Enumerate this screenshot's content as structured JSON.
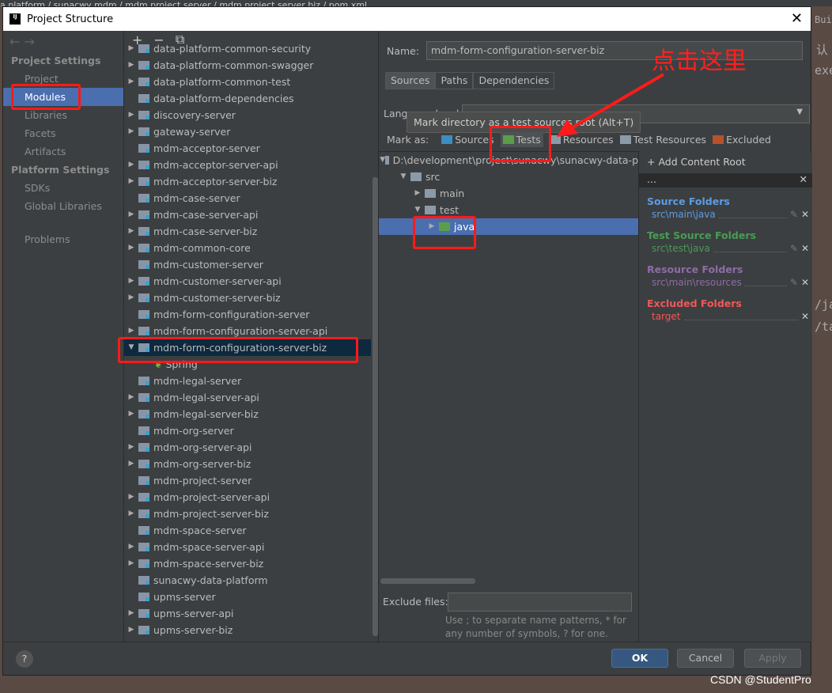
{
  "background": {
    "breadcrumb": "a platform / sunacwy mdm / mdm project server / mdm project server biz / pom.xml",
    "side_text": [
      "Buil",
      "认",
      "exe",
      "/ja",
      "/ta"
    ],
    "watermark": "CSDN @StudentPro"
  },
  "dialog": {
    "title": "Project Structure",
    "close": "✕"
  },
  "left": {
    "project_settings": "Project Settings",
    "items1": [
      "Project",
      "Modules",
      "Libraries",
      "Facets",
      "Artifacts"
    ],
    "platform_settings": "Platform Settings",
    "items2": [
      "SDKs",
      "Global Libraries"
    ],
    "problems": "Problems",
    "selected": "Modules"
  },
  "modules_toolbar": {
    "add": "+",
    "remove": "−",
    "copy": "⧉"
  },
  "modules": [
    {
      "name": "data-platform-common-security",
      "arrow": "right"
    },
    {
      "name": "data-platform-common-swagger",
      "arrow": "right"
    },
    {
      "name": "data-platform-common-test",
      "arrow": "right"
    },
    {
      "name": "data-platform-dependencies",
      "arrow": ""
    },
    {
      "name": "discovery-server",
      "arrow": "right"
    },
    {
      "name": "gateway-server",
      "arrow": "right"
    },
    {
      "name": "mdm-acceptor-server",
      "arrow": ""
    },
    {
      "name": "mdm-acceptor-server-api",
      "arrow": "right"
    },
    {
      "name": "mdm-acceptor-server-biz",
      "arrow": "right"
    },
    {
      "name": "mdm-case-server",
      "arrow": ""
    },
    {
      "name": "mdm-case-server-api",
      "arrow": "right"
    },
    {
      "name": "mdm-case-server-biz",
      "arrow": "right"
    },
    {
      "name": "mdm-common-core",
      "arrow": "right"
    },
    {
      "name": "mdm-customer-server",
      "arrow": ""
    },
    {
      "name": "mdm-customer-server-api",
      "arrow": "right"
    },
    {
      "name": "mdm-customer-server-biz",
      "arrow": "right"
    },
    {
      "name": "mdm-form-configuration-server",
      "arrow": ""
    },
    {
      "name": "mdm-form-configuration-server-api",
      "arrow": "right"
    },
    {
      "name": "mdm-form-configuration-server-biz",
      "arrow": "down",
      "selected": true
    },
    {
      "name": "Spring",
      "arrow": "",
      "child": true
    },
    {
      "name": "mdm-legal-server",
      "arrow": ""
    },
    {
      "name": "mdm-legal-server-api",
      "arrow": "right"
    },
    {
      "name": "mdm-legal-server-biz",
      "arrow": "right"
    },
    {
      "name": "mdm-org-server",
      "arrow": ""
    },
    {
      "name": "mdm-org-server-api",
      "arrow": "right"
    },
    {
      "name": "mdm-org-server-biz",
      "arrow": "right"
    },
    {
      "name": "mdm-project-server",
      "arrow": ""
    },
    {
      "name": "mdm-project-server-api",
      "arrow": "right"
    },
    {
      "name": "mdm-project-server-biz",
      "arrow": "right"
    },
    {
      "name": "mdm-space-server",
      "arrow": ""
    },
    {
      "name": "mdm-space-server-api",
      "arrow": "right"
    },
    {
      "name": "mdm-space-server-biz",
      "arrow": "right"
    },
    {
      "name": "sunacwy-data-platform",
      "arrow": ""
    },
    {
      "name": "upms-server",
      "arrow": ""
    },
    {
      "name": "upms-server-api",
      "arrow": "right"
    },
    {
      "name": "upms-server-biz",
      "arrow": "right"
    }
  ],
  "detail": {
    "name_label": "Name:",
    "name_value": "mdm-form-configuration-server-biz",
    "tabs": [
      "Sources",
      "Paths",
      "Dependencies"
    ],
    "active_tab": "Sources",
    "lang_label": "Language level:",
    "tooltip": "Mark directory as a test sources root (Alt+T)",
    "mark_as": "Mark as:",
    "marks": [
      {
        "label": "Sources",
        "color": "#3d8dbf"
      },
      {
        "label": "Tests",
        "color": "#5a9e4a"
      },
      {
        "label": "Resources",
        "color": "#8c9aa8"
      },
      {
        "label": "Test Resources",
        "color": "#8c9aa8"
      },
      {
        "label": "Excluded",
        "color": "#b5532b"
      }
    ],
    "tree": [
      {
        "label": "D:\\development\\project\\sunacwy\\sunacwy-data-p",
        "arrow": "▼",
        "indent": 0
      },
      {
        "label": "src",
        "arrow": "▼",
        "indent": 1
      },
      {
        "label": "main",
        "arrow": "▶",
        "indent": 2
      },
      {
        "label": "test",
        "arrow": "▼",
        "indent": 2
      },
      {
        "label": "java",
        "arrow": "▶",
        "indent": 3,
        "selected": true,
        "green": true
      }
    ],
    "exclude_label": "Exclude files:",
    "exclude_value": "",
    "hint": "Use ; to separate name patterns, * for any number of symbols, ? for one.",
    "annotation": "点击这里"
  },
  "content_root": {
    "add": "+ Add Content Root",
    "header": "...",
    "groups": [
      {
        "title": "Source Folders",
        "path": "src\\main\\java",
        "color": "#5c9ce6"
      },
      {
        "title": "Test Source Folders",
        "path": "src\\test\\java",
        "color": "#499c54"
      },
      {
        "title": "Resource Folders",
        "path": "src\\main\\resources",
        "color": "#8e6ba8"
      },
      {
        "title": "Excluded Folders",
        "path": "target",
        "color": "#f05858"
      }
    ]
  },
  "buttons": {
    "help": "?",
    "ok": "OK",
    "cancel": "Cancel",
    "apply": "Apply"
  }
}
